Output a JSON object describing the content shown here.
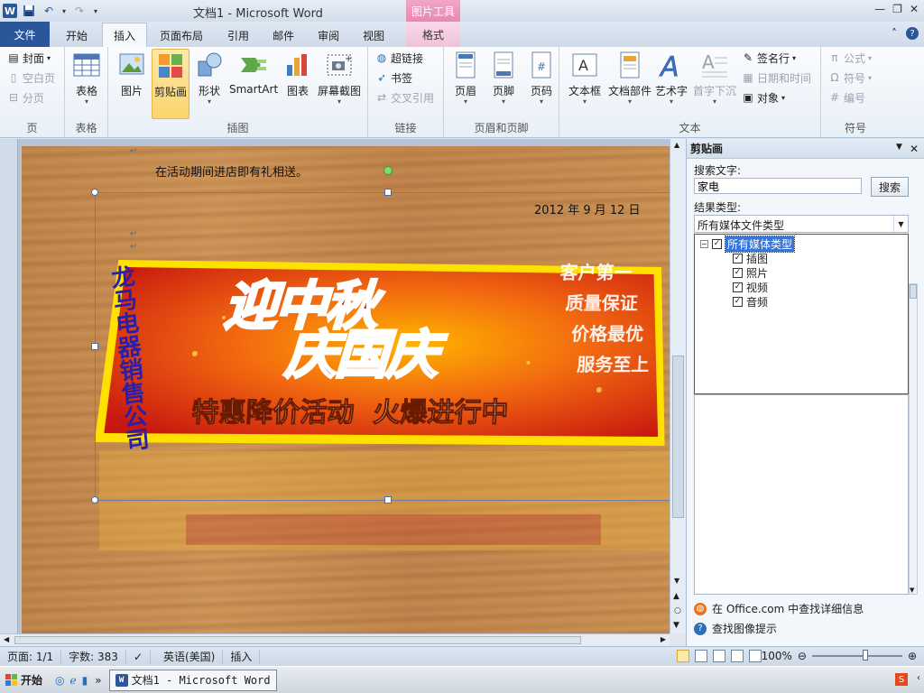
{
  "window": {
    "title": "文档1 - Microsoft Word",
    "context_tab_header": "图片工具"
  },
  "quick_access": {
    "undo_arrow": "▾",
    "customize": "▾"
  },
  "tabs": [
    {
      "label": "文件"
    },
    {
      "label": "开始"
    },
    {
      "label": "插入"
    },
    {
      "label": "页面布局"
    },
    {
      "label": "引用"
    },
    {
      "label": "邮件"
    },
    {
      "label": "审阅"
    },
    {
      "label": "视图"
    },
    {
      "label": "格式"
    }
  ],
  "ribbon": {
    "page_group": {
      "label": "页",
      "cover": "封面",
      "blank": "空白页",
      "break": "分页"
    },
    "table_group": {
      "label": "表格",
      "table": "表格"
    },
    "illustrations_group": {
      "label": "插图",
      "picture": "图片",
      "clipart": "剪贴画",
      "shapes": "形状",
      "smartart": "SmartArt",
      "chart": "图表",
      "screenshot": "屏幕截图"
    },
    "links_group": {
      "label": "链接",
      "hyperlink": "超链接",
      "bookmark": "书签",
      "crossref": "交叉引用"
    },
    "header_footer_group": {
      "label": "页眉和页脚",
      "header": "页眉",
      "footer": "页脚",
      "pagenum": "页码"
    },
    "text_group": {
      "label": "文本",
      "textbox": "文本框",
      "quickparts": "文档部件",
      "wordart": "艺术字",
      "dropcap": "首字下沉",
      "signature": "签名行",
      "datetime": "日期和时间",
      "object": "对象"
    },
    "symbols_group": {
      "label": "符号",
      "equation": "公式",
      "symbol": "符号",
      "number": "编号"
    }
  },
  "document": {
    "line1": "在活动期间进店即有礼相送。",
    "date": "2012 年 9 月 12 日",
    "banner": {
      "company": "龙马电器销售公司",
      "headline1": "迎中秋",
      "headline2": "庆国庆",
      "slogan": "特惠降价活动  火爆进行中",
      "side_lines": [
        "客户第一",
        "质量保证",
        "价格最优",
        "服务至上"
      ]
    }
  },
  "clipart_pane": {
    "title": "剪贴画",
    "search_label": "搜索文字:",
    "search_value": "家电",
    "search_button": "搜索",
    "result_type_label": "结果类型:",
    "result_type_value": "所有媒体文件类型",
    "tree_root": "所有媒体类型",
    "tree_items": [
      "插图",
      "照片",
      "视频",
      "音频"
    ],
    "office_link": "在 Office.com 中查找详细信息",
    "tips_link": "查找图像提示"
  },
  "statusbar": {
    "page": "页面: 1/1",
    "words": "字数: 383",
    "language": "英语(美国)",
    "mode": "插入",
    "zoom": "100%"
  },
  "taskbar": {
    "start": "开始",
    "task": "文档1 - Microsoft Word"
  },
  "colors": {
    "word_blue": "#2b579a",
    "banner_red": "#d8261c",
    "banner_yellow": "#ffe100",
    "selected_btn": "#fcd56e"
  }
}
